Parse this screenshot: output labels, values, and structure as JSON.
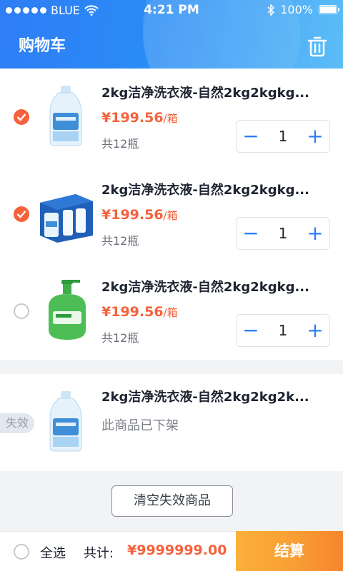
{
  "status_bar": {
    "carrier": "BLUE",
    "time": "4:21 PM",
    "battery": "100%"
  },
  "header": {
    "title": "购物车"
  },
  "cart": {
    "items": [
      {
        "name": "2kg洁净洗衣液-自然2kg2kgkg...",
        "price": "¥199.56",
        "unit": "/箱",
        "count": "共12瓶",
        "qty": "1",
        "checked": true
      },
      {
        "name": "2kg洁净洗衣液-自然2kg2kgkg...",
        "price": "¥199.56",
        "unit": "/箱",
        "count": "共12瓶",
        "qty": "1",
        "checked": true
      },
      {
        "name": "2kg洁净洗衣液-自然2kg2kgkg...",
        "price": "¥199.56",
        "unit": "/箱",
        "count": "共12瓶",
        "qty": "1",
        "checked": false
      }
    ],
    "stepper": {
      "minus": "−",
      "plus": "+"
    }
  },
  "invalid": {
    "badge": "失效",
    "name": "2kg洁净洗衣液-自然2kg2kg2k...",
    "status": "此商品已下架"
  },
  "clear_button": "清空失效商品",
  "footer": {
    "select_all": "全选",
    "total_label": "共计:",
    "total": "¥9999999.00",
    "checkout": "结算"
  },
  "colors": {
    "primary": "#2f7df6",
    "accent": "#f5623c",
    "checkout": "#f7852d"
  }
}
